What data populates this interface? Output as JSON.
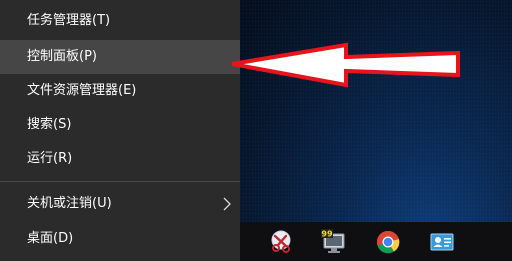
{
  "menu": {
    "items": [
      {
        "label": "任务管理器(T)"
      },
      {
        "label": "控制面板(P)"
      },
      {
        "label": "文件资源管理器(E)"
      },
      {
        "label": "搜索(S)"
      },
      {
        "label": "运行(R)"
      },
      {
        "label": "关机或注销(U)"
      },
      {
        "label": "桌面(D)"
      }
    ]
  },
  "taskbar": {
    "icons": [
      {
        "name": "snipping-tool-icon"
      },
      {
        "name": "display-99-icon",
        "badge": "99"
      },
      {
        "name": "chrome-icon"
      },
      {
        "name": "contact-card-icon"
      }
    ]
  },
  "colors": {
    "menu_bg": "#2b2b2b",
    "menu_hover": "#464646",
    "annotation_arrow": "#e8141c"
  }
}
